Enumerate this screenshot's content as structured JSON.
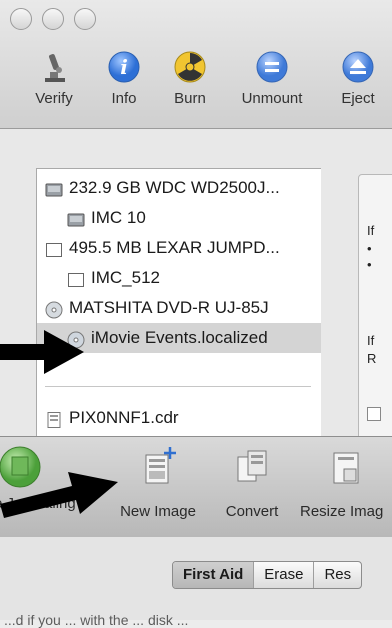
{
  "disk_utility": {
    "toolbar": [
      {
        "label": "Verify",
        "icon": "microscope-icon"
      },
      {
        "label": "Info",
        "icon": "info-icon"
      },
      {
        "label": "Burn",
        "icon": "burn-icon"
      },
      {
        "label": "Unmount",
        "icon": "unmount-icon"
      },
      {
        "label": "Eject",
        "icon": "eject-icon"
      }
    ],
    "sidebar": {
      "items": [
        {
          "label": "232.9 GB WDC WD2500J...",
          "icon": "hard-drive-icon"
        },
        {
          "label": "IMC 10",
          "icon": "volume-icon"
        },
        {
          "label": "495.5 MB LEXAR JUMPD...",
          "icon": "usb-drive-icon"
        },
        {
          "label": "IMC_512",
          "icon": "volume-icon"
        },
        {
          "label": "MATSHITA DVD-R UJ-85J",
          "icon": "optical-drive-icon"
        },
        {
          "label": "iMovie Events.localized",
          "icon": "disc-icon",
          "selected": true
        },
        {
          "label": "PIX0NNF1.cdr",
          "icon": "disk-image-icon"
        }
      ]
    },
    "right_panel": {
      "fragments": [
        "If",
        "•",
        "•",
        "If",
        "R"
      ]
    }
  },
  "second_window": {
    "toolbar": [
      {
        "label": "e Journaling",
        "icon": "journaling-icon"
      },
      {
        "label": "New Image",
        "icon": "new-image-icon"
      },
      {
        "label": "Convert",
        "icon": "convert-icon"
      },
      {
        "label": "Resize Imag",
        "icon": "resize-image-icon"
      }
    ],
    "tabs": [
      "First Aid",
      "Erase",
      "Res"
    ],
    "active_tab": "First Aid",
    "description_fragment": "...d if you ... with the ... disk ..."
  },
  "annotations": {
    "arrow_color": "#000000",
    "arrows": [
      "pointing to iMovie Events.localized",
      "pointing to New Image"
    ]
  }
}
